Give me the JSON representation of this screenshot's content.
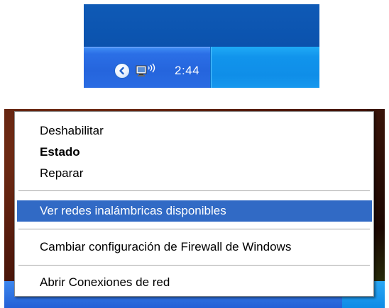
{
  "taskbar": {
    "clock": "2:44",
    "icons": [
      "show-hidden-icons-chevron",
      "wireless-network-icon"
    ]
  },
  "context_menu": {
    "items": [
      {
        "label": "Deshabilitar",
        "bold": false,
        "highlighted": false
      },
      {
        "label": "Estado",
        "bold": true,
        "highlighted": false
      },
      {
        "label": "Reparar",
        "bold": false,
        "highlighted": false
      },
      {
        "label": "Ver redes inalámbricas disponibles",
        "bold": false,
        "highlighted": true
      },
      {
        "label": "Cambiar configuración de Firewall de Windows",
        "bold": false,
        "highlighted": false
      },
      {
        "label": "Abrir Conexiones de red",
        "bold": false,
        "highlighted": false
      }
    ]
  },
  "colors": {
    "highlight": "#316ac5",
    "taskbar": "#2565dd",
    "tray": "#0f8ee8"
  }
}
